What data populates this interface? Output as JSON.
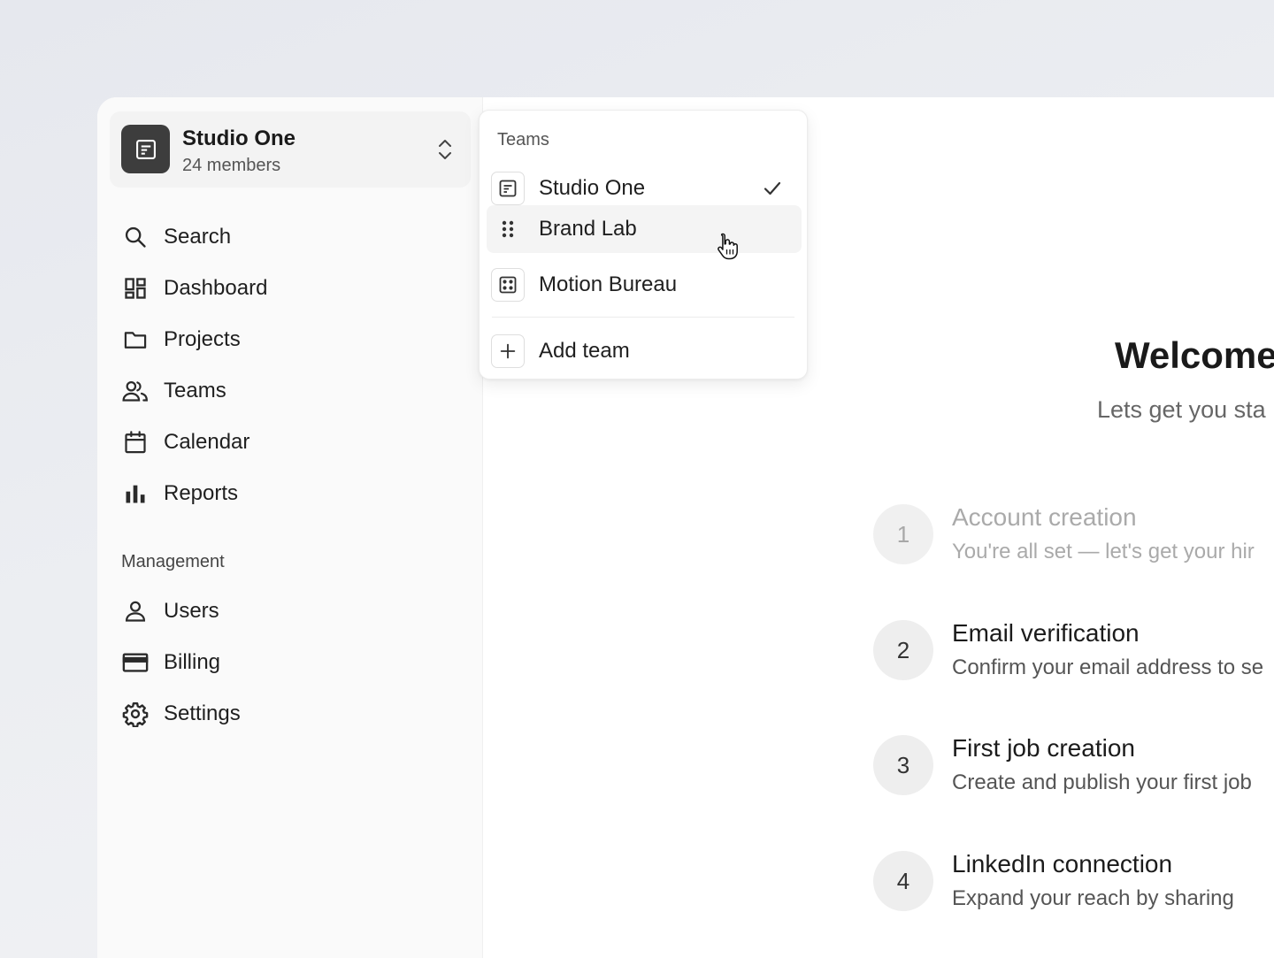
{
  "team_switcher": {
    "name": "Studio One",
    "members": "24 members",
    "logo_icon": "document-icon",
    "toggle_icon": "chevron-up-down-icon"
  },
  "nav": {
    "items": [
      {
        "label": "Search",
        "icon": "search-icon"
      },
      {
        "label": "Dashboard",
        "icon": "dashboard-icon"
      },
      {
        "label": "Projects",
        "icon": "folder-icon"
      },
      {
        "label": "Teams",
        "icon": "users-icon"
      },
      {
        "label": "Calendar",
        "icon": "calendar-icon"
      },
      {
        "label": "Reports",
        "icon": "bar-chart-icon"
      }
    ],
    "management_label": "Management",
    "management_items": [
      {
        "label": "Users",
        "icon": "user-icon"
      },
      {
        "label": "Billing",
        "icon": "credit-card-icon"
      },
      {
        "label": "Settings",
        "icon": "gear-icon"
      }
    ]
  },
  "dropdown": {
    "header": "Teams",
    "items": [
      {
        "label": "Studio One",
        "icon": "document-icon",
        "selected": true
      },
      {
        "label": "Brand Lab",
        "icon": "drag-handle-icon",
        "hovered": true
      },
      {
        "label": "Motion Bureau",
        "icon": "dice-icon"
      }
    ],
    "add_label": "Add team",
    "add_icon": "plus-icon"
  },
  "main": {
    "title": "Welcome",
    "subtitle": "Lets get you sta",
    "steps": [
      {
        "number": "1",
        "title": "Account creation",
        "desc": "You're all set — let's get your hir",
        "done": true
      },
      {
        "number": "2",
        "title": "Email verification",
        "desc": "Confirm your email address to se"
      },
      {
        "number": "3",
        "title": "First job creation",
        "desc": "Create and publish your first job"
      },
      {
        "number": "4",
        "title": "LinkedIn connection",
        "desc": "Expand your reach by sharing"
      }
    ]
  },
  "colors": {
    "background": "#e9ebf0",
    "sidebar": "#fafafa",
    "logo": "#3d3d3d",
    "text": "#1f1f1f",
    "muted": "#aaaaaa"
  }
}
